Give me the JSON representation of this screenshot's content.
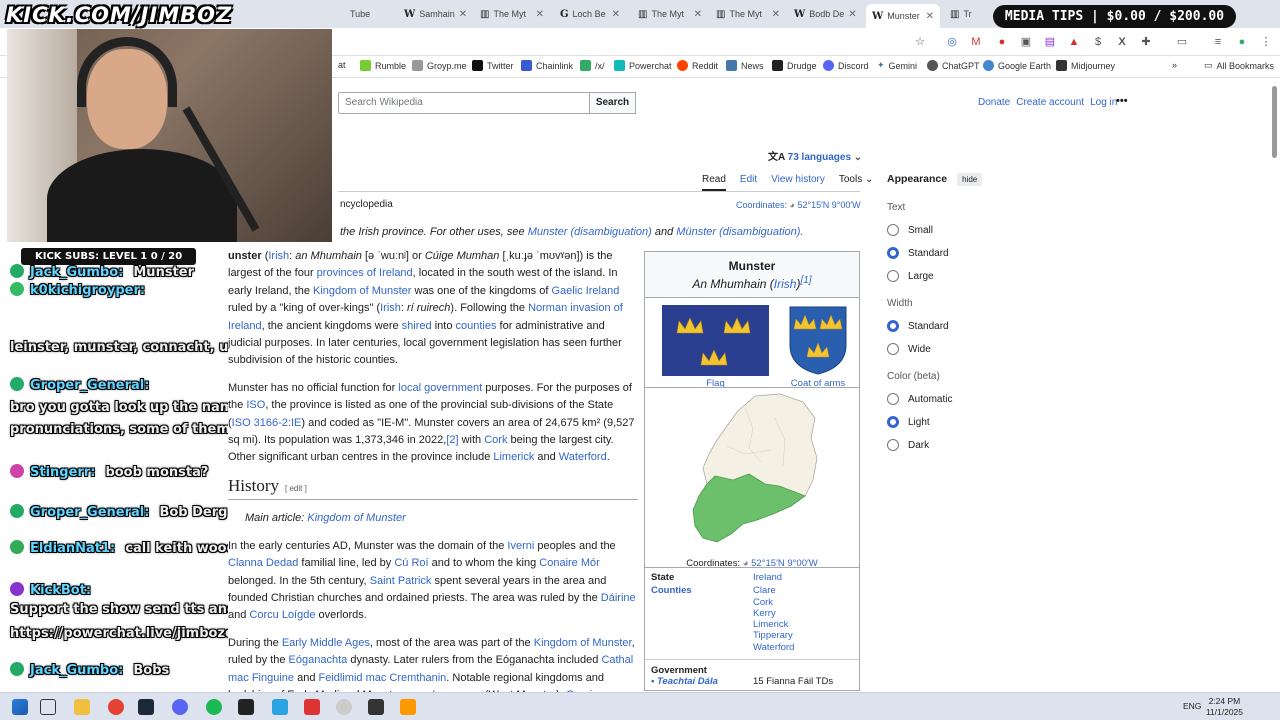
{
  "overlay": {
    "stream_logo": "KICK.COM/JIMBOZ",
    "kick_subs": "KICK SUBS: LEVEL 1 0 / 20",
    "media_tips": "MEDIA TIPS | $0.00 / $200.00",
    "chat": [
      {
        "user": "Jack_Gumbo:",
        "msg": "Munster"
      },
      {
        "user": "k0kichigroyper:",
        "msg": ""
      },
      {
        "user": "",
        "msg": "leinster, munster, connacht, ulster"
      },
      {
        "user": "Groper_General:",
        "msg": ""
      },
      {
        "user": "",
        "msg": "bro you gotta look up the name"
      },
      {
        "user": "",
        "msg": "pronunciations, some of them are crazy"
      },
      {
        "user": "Stingerr:",
        "msg": "boob monsta?"
      },
      {
        "user": "Groper_General:",
        "msg": "Bob Derg"
      },
      {
        "user": "EldianNat1:",
        "msg": "call keith woods"
      },
      {
        "user": "KickBot:",
        "msg": ""
      },
      {
        "user": "",
        "msg": "Support the show send tts and media!"
      },
      {
        "user": "",
        "msg": "https://powerchat.live/jimbozoomer"
      },
      {
        "user": "Jack_Gumbo:",
        "msg": "Bobs"
      }
    ]
  },
  "browser": {
    "tabs": [
      {
        "label": "Tube"
      },
      {
        "label": "Samhain"
      },
      {
        "label": "The Myt"
      },
      {
        "label": "Loch Be"
      },
      {
        "label": "The Myt"
      },
      {
        "label": "The Myt"
      },
      {
        "label": "Bodb De"
      },
      {
        "label": "Munster"
      },
      {
        "label": "Tr"
      }
    ],
    "bookmarks": [
      "at",
      "Rumble",
      "Groyp.me",
      "Twitter",
      "Chainlink",
      "/x/",
      "Powerchat",
      "Reddit",
      "News",
      "Drudge",
      "Discord",
      "Gemini",
      "ChatGPT",
      "Google Earth",
      "Midjourney",
      "All Bookmarks"
    ]
  },
  "wiki": {
    "search_placeholder": "Search Wikipedia",
    "search_button": "Search",
    "user_links": [
      "Donate",
      "Create account",
      "Log in"
    ],
    "more": "•••",
    "languages": "73 languages",
    "tabs": {
      "read": "Read",
      "edit": "Edit",
      "history": "View history",
      "tools": "Tools"
    },
    "tagline": "ncyclopedia",
    "coordinates_label": "Coordinates:",
    "coordinates_value": "52°15′N 9°00′W",
    "hatnote_prefix": "the Irish province. For other uses, see ",
    "hatnote_link1": "Munster (disambiguation)",
    "hatnote_and": " and ",
    "hatnote_link2": "Münster (disambiguation).",
    "p1": [
      {
        "t": "unster ",
        "b": true
      },
      {
        "t": "(",
        "b": false
      },
      {
        "t": "Irish",
        "l": true
      },
      {
        "t": ": ",
        "b": false
      },
      {
        "t": "an Mhumhain",
        "i": true
      },
      {
        "t": " [ə ˈwuːnʲ] or ",
        "b": false
      },
      {
        "t": "Cúige Mumhan",
        "i": true
      },
      {
        "t": " [ˌkuːɟə ˈmʊvˠən]) is the largest of the four ",
        "b": false
      },
      {
        "t": "provinces of Ireland",
        "l": true
      },
      {
        "t": ", located in the south west of the island. In early Ireland, the ",
        "b": false
      },
      {
        "t": "Kingdom of Munster",
        "l": true
      },
      {
        "t": " was one of the kingdoms of ",
        "b": false
      },
      {
        "t": "Gaelic Ireland",
        "l": true
      },
      {
        "t": " ruled by a \"king of over-kings\" (",
        "b": false
      },
      {
        "t": "Irish",
        "l": true
      },
      {
        "t": ": ",
        "b": false
      },
      {
        "t": "rí ruirech",
        "i": true
      },
      {
        "t": "). Following the ",
        "b": false
      },
      {
        "t": "Norman invasion of Ireland",
        "l": true
      },
      {
        "t": ", the ancient kingdoms were ",
        "b": false
      },
      {
        "t": "shired",
        "l": true
      },
      {
        "t": " into ",
        "b": false
      },
      {
        "t": "counties",
        "l": true
      },
      {
        "t": " for administrative and judicial purposes. In later centuries, local government legislation has seen further subdivision of the historic counties.",
        "b": false
      }
    ],
    "p2": [
      {
        "t": "Munster has no official function for "
      },
      {
        "t": "local government",
        "l": true
      },
      {
        "t": " purposes. For the purposes of the "
      },
      {
        "t": "ISO",
        "l": true
      },
      {
        "t": ", the province is listed as one of the provincial sub-divisions of the State ("
      },
      {
        "t": "ISO 3166-2:IE",
        "l": true
      },
      {
        "t": ") and coded as \"IE-M\". Munster covers an area of 24,675 km² (9,527 sq mi). Its population was 1,373,346 in 2022,"
      },
      {
        "t": "[2]",
        "l": true
      },
      {
        "t": " with "
      },
      {
        "t": "Cork",
        "l": true
      },
      {
        "t": " being the largest city. Other significant urban centres in the province include "
      },
      {
        "t": "Limerick",
        "l": true
      },
      {
        "t": " and "
      },
      {
        "t": "Waterford",
        "l": true
      },
      {
        "t": "."
      }
    ],
    "history_heading": "History",
    "history_edit": "[ edit ]",
    "main_article_prefix": "Main article: ",
    "main_article_link": "Kingdom of Munster",
    "p3": [
      {
        "t": "In the early centuries AD, Munster was the domain of the "
      },
      {
        "t": "Iverni",
        "l": true
      },
      {
        "t": " peoples and the "
      },
      {
        "t": "Clanna Dedad",
        "l": true
      },
      {
        "t": " familial line, led by "
      },
      {
        "t": "Cú Roí",
        "l": true
      },
      {
        "t": " and to whom the king "
      },
      {
        "t": "Conaire Mór",
        "l": true
      },
      {
        "t": " belonged. In the 5th century, "
      },
      {
        "t": "Saint Patrick",
        "l": true
      },
      {
        "t": " spent several years in the area and founded Christian churches and ordained priests. The area was ruled by the "
      },
      {
        "t": "Dáirine",
        "l": true
      },
      {
        "t": " and "
      },
      {
        "t": "Corcu Loígde",
        "l": true
      },
      {
        "t": " overlords."
      }
    ],
    "p4": [
      {
        "t": "During the "
      },
      {
        "t": "Early Middle Ages",
        "l": true
      },
      {
        "t": ", most of the area was part of the "
      },
      {
        "t": "Kingdom of Munster",
        "l": true
      },
      {
        "t": ", ruled by the "
      },
      {
        "t": "Eóganachta",
        "l": true
      },
      {
        "t": " dynasty. Later rulers from the Eóganachta included "
      },
      {
        "t": "Cathal mac Finguine",
        "l": true
      },
      {
        "t": " and "
      },
      {
        "t": "Feidlimid mac Cremthanin",
        "l": true
      },
      {
        "t": ". Notable regional kingdoms and lordships of Early Medieval Munster were "
      },
      {
        "t": "Iarmuman",
        "l": true
      },
      {
        "t": " (West Munster), "
      },
      {
        "t": "Osraige",
        "l": true
      }
    ],
    "infobox": {
      "title": "Munster",
      "subtitle": "An Mhumhain",
      "sub_lang": "Irish",
      "sub_ref": "[1]",
      "flag_label": "Flag",
      "coa_label": "Coat of arms",
      "coords_label": "Coordinates:",
      "coords_value": "52°15′N 9°00′W",
      "state_label": "State",
      "state_value": "Ireland",
      "counties_label": "Counties",
      "counties": [
        "Clare",
        "Cork",
        "Kerry",
        "Limerick",
        "Tipperary",
        "Waterford"
      ],
      "government_label": "Government",
      "teachtai_label": "• Teachtaí Dála",
      "teachtai_value": "15 Fianna Fáil TDs"
    },
    "appearance": {
      "title": "Appearance",
      "hide": "hide",
      "text_label": "Text",
      "text_options": [
        "Small",
        "Standard",
        "Large"
      ],
      "text_selected": "Standard",
      "width_label": "Width",
      "width_options": [
        "Standard",
        "Wide"
      ],
      "width_selected": "Standard",
      "color_label": "Color (beta)",
      "color_options": [
        "Automatic",
        "Light",
        "Dark"
      ],
      "color_selected": "Light"
    }
  },
  "taskbar": {
    "lang": "ENG",
    "time": "2:24 PM",
    "date": "11/1/2025"
  }
}
